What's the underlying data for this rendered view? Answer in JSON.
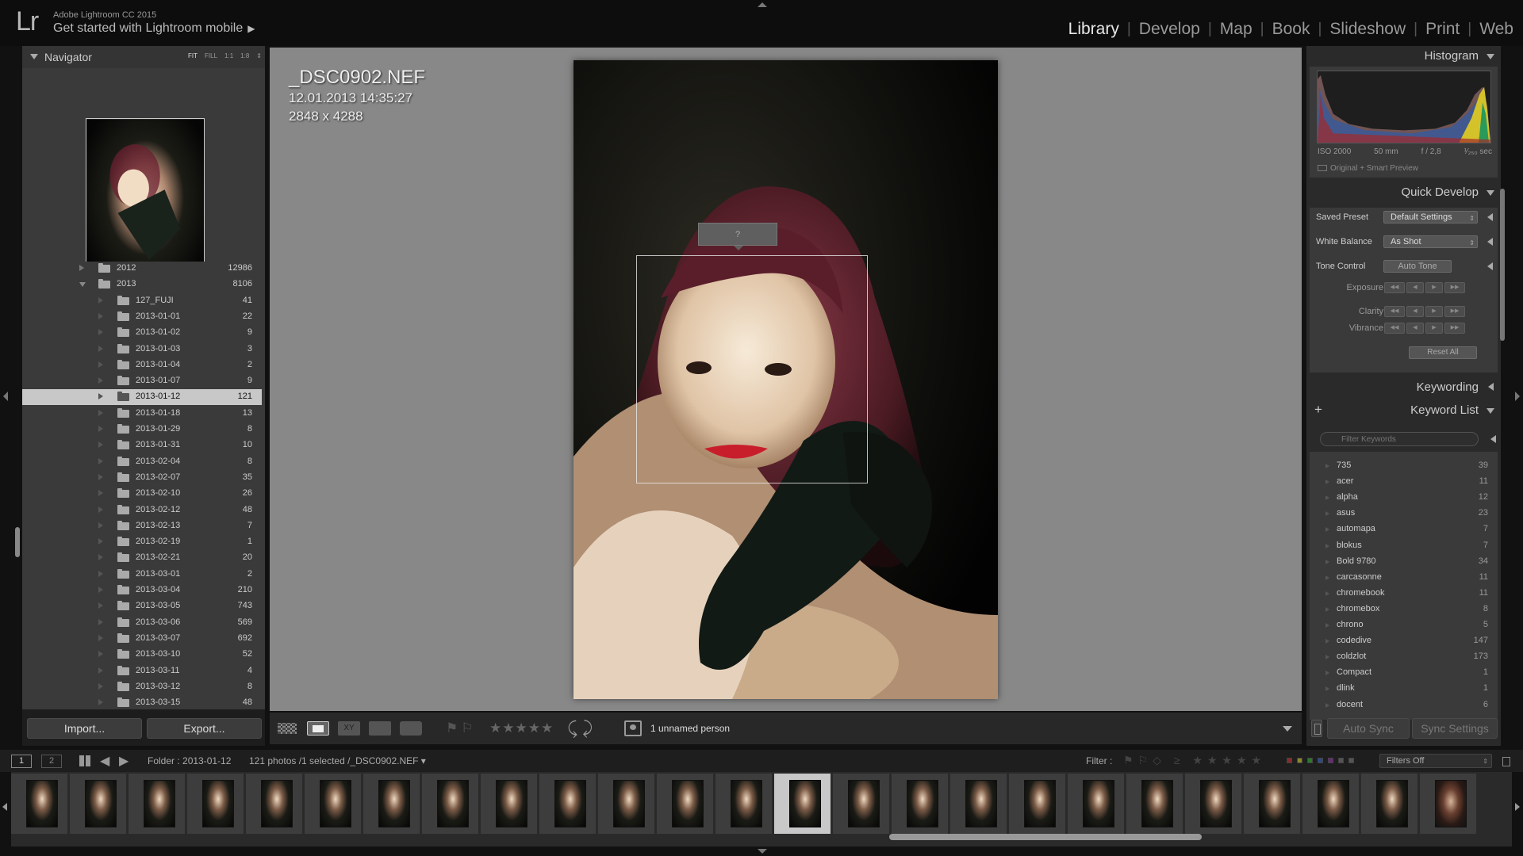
{
  "app": {
    "logo": "Lr",
    "product": "Adobe Lightroom CC 2015",
    "mobile_prompt": "Get started with Lightroom mobile",
    "mobile_arrow": "▶"
  },
  "modules": [
    {
      "label": "Library",
      "active": true
    },
    {
      "label": "Develop"
    },
    {
      "label": "Map"
    },
    {
      "label": "Book"
    },
    {
      "label": "Slideshow"
    },
    {
      "label": "Print"
    },
    {
      "label": "Web"
    }
  ],
  "navigator": {
    "title": "Navigator",
    "zoom_options": [
      "FIT",
      "FILL",
      "1:1",
      "1:8",
      "⇕"
    ]
  },
  "folders": [
    {
      "name": "2012",
      "count": "12986",
      "level": 0,
      "state": "closed"
    },
    {
      "name": "2013",
      "count": "8106",
      "level": 0,
      "state": "open"
    },
    {
      "name": "127_FUJI",
      "count": "41",
      "level": 1
    },
    {
      "name": "2013-01-01",
      "count": "22",
      "level": 1
    },
    {
      "name": "2013-01-02",
      "count": "9",
      "level": 1
    },
    {
      "name": "2013-01-03",
      "count": "3",
      "level": 1
    },
    {
      "name": "2013-01-04",
      "count": "2",
      "level": 1
    },
    {
      "name": "2013-01-07",
      "count": "9",
      "level": 1
    },
    {
      "name": "2013-01-12",
      "count": "121",
      "level": 1,
      "selected": true
    },
    {
      "name": "2013-01-18",
      "count": "13",
      "level": 1
    },
    {
      "name": "2013-01-29",
      "count": "8",
      "level": 1
    },
    {
      "name": "2013-01-31",
      "count": "10",
      "level": 1
    },
    {
      "name": "2013-02-04",
      "count": "8",
      "level": 1
    },
    {
      "name": "2013-02-07",
      "count": "35",
      "level": 1
    },
    {
      "name": "2013-02-10",
      "count": "26",
      "level": 1
    },
    {
      "name": "2013-02-12",
      "count": "48",
      "level": 1
    },
    {
      "name": "2013-02-13",
      "count": "7",
      "level": 1
    },
    {
      "name": "2013-02-19",
      "count": "1",
      "level": 1
    },
    {
      "name": "2013-02-21",
      "count": "20",
      "level": 1
    },
    {
      "name": "2013-03-01",
      "count": "2",
      "level": 1
    },
    {
      "name": "2013-03-04",
      "count": "210",
      "level": 1
    },
    {
      "name": "2013-03-05",
      "count": "743",
      "level": 1
    },
    {
      "name": "2013-03-06",
      "count": "569",
      "level": 1
    },
    {
      "name": "2013-03-07",
      "count": "692",
      "level": 1
    },
    {
      "name": "2013-03-10",
      "count": "52",
      "level": 1
    },
    {
      "name": "2013-03-11",
      "count": "4",
      "level": 1
    },
    {
      "name": "2013-03-12",
      "count": "8",
      "level": 1
    },
    {
      "name": "2013-03-15",
      "count": "48",
      "level": 1
    }
  ],
  "left_buttons": {
    "import": "Import...",
    "export": "Export..."
  },
  "photo": {
    "filename": "_DSC0902.NEF",
    "datetime": "12.01.2013 14:35:27",
    "dimensions": "2848 x 4288",
    "face_label": "?"
  },
  "toolbar": {
    "flags": "⚑⚐",
    "stars": "★★★★★",
    "rotate": "⤹⤸",
    "people_text": "1 unnamed person"
  },
  "histogram": {
    "title": "Histogram",
    "iso": "ISO 2000",
    "focal": "50 mm",
    "aperture": "f / 2,8",
    "shutter": "¹⁄₂₅₀ sec",
    "preview_label": "Original + Smart Preview"
  },
  "quick_develop": {
    "title": "Quick Develop",
    "saved_preset_label": "Saved Preset",
    "saved_preset_value": "Default Settings",
    "white_balance_label": "White Balance",
    "white_balance_value": "As Shot",
    "tone_control_label": "Tone Control",
    "auto_tone": "Auto Tone",
    "exposure": "Exposure",
    "clarity": "Clarity",
    "vibrance": "Vibrance",
    "reset_all": "Reset All"
  },
  "keywording": {
    "title": "Keywording"
  },
  "keyword_list": {
    "title": "Keyword List",
    "add": "+",
    "filter_placeholder": "Filter Keywords",
    "items": [
      {
        "name": "735",
        "count": "39"
      },
      {
        "name": "acer",
        "count": "11"
      },
      {
        "name": "alpha",
        "count": "12"
      },
      {
        "name": "asus",
        "count": "23"
      },
      {
        "name": "automapa",
        "count": "7"
      },
      {
        "name": "blokus",
        "count": "7"
      },
      {
        "name": "Bold 9780",
        "count": "34"
      },
      {
        "name": "carcasonne",
        "count": "11"
      },
      {
        "name": "chromebook",
        "count": "11"
      },
      {
        "name": "chromebox",
        "count": "8"
      },
      {
        "name": "chrono",
        "count": "5"
      },
      {
        "name": "codedive",
        "count": "147"
      },
      {
        "name": "coldzlot",
        "count": "173"
      },
      {
        "name": "Compact",
        "count": "1"
      },
      {
        "name": "dlink",
        "count": "1"
      },
      {
        "name": "docent",
        "count": "6"
      }
    ]
  },
  "sync": {
    "auto_sync": "Auto Sync",
    "sync_settings": "Sync Settings"
  },
  "filmstrip_bar": {
    "view1": "1",
    "view2": "2",
    "back": "◀",
    "forward": "▶",
    "folder": "Folder : 2013-01-12",
    "count": "121 photos /1 selected /_DSC0902.NEF ▾",
    "filter_label": "Filter :",
    "filter_icons": "⚑⚐◇ ≥ ★★★★★",
    "filters_off": "Filters Off",
    "selected_index": 13,
    "thumb_count": 25,
    "color_labels": [
      "#8a2a2a",
      "#8a8a2a",
      "#2a7a2a",
      "#2a4a8a",
      "#6a2a7a",
      "#555555",
      "#555555"
    ]
  }
}
